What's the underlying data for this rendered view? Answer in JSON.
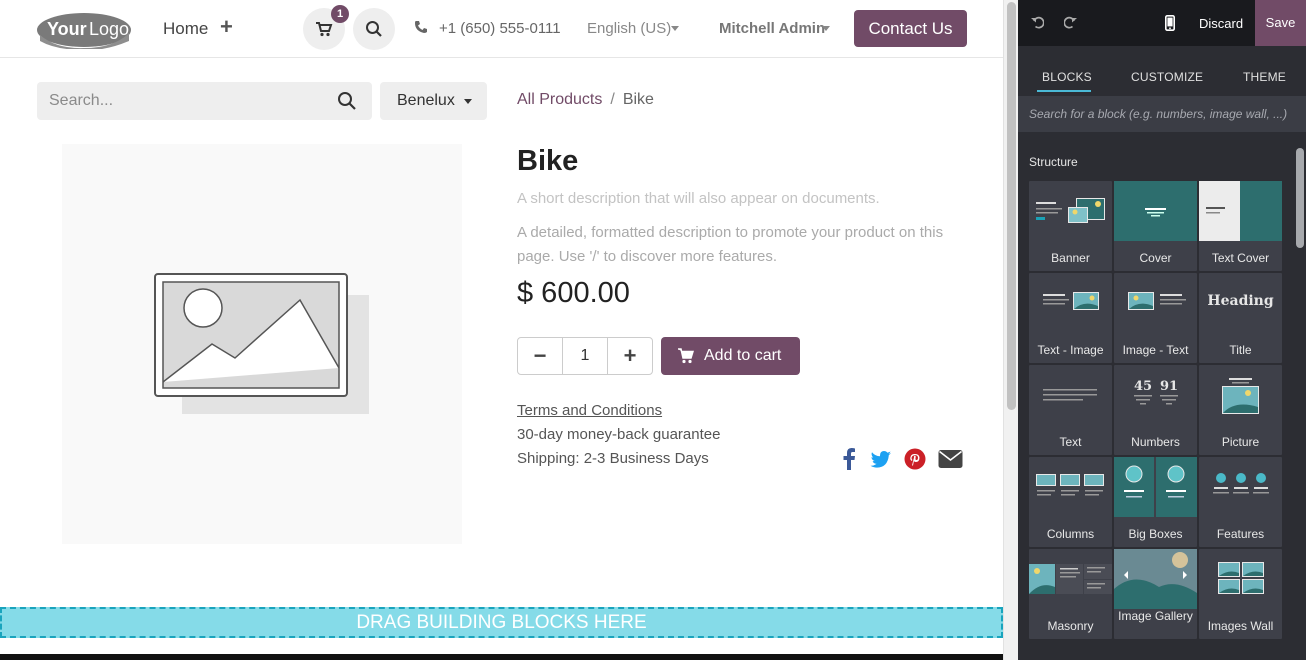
{
  "header": {
    "logo_alt": "Your Logo",
    "nav_home": "Home",
    "nav_add": "+",
    "cart_count": "1",
    "phone": "+1 (650) 555-0111",
    "language": "English (US)",
    "user": "Mitchell Admin",
    "contact_label": "Contact Us"
  },
  "toolbar": {
    "search_placeholder": "Search...",
    "pricelist": "Benelux",
    "breadcrumb": {
      "parent": "All Products",
      "sep": "/",
      "current": "Bike"
    }
  },
  "product": {
    "title": "Bike",
    "short_description": "A short description that will also appear on documents.",
    "long_description": "A detailed, formatted description to promote your product on this page. Use '/' to discover more features.",
    "price": "$ 600.00",
    "quantity": "1",
    "minus": "−",
    "plus": "+",
    "add_to_cart": "Add to cart",
    "terms": "Terms and Conditions",
    "guarantee": "30-day money-back guarantee",
    "shipping": "Shipping: 2-3 Business Days",
    "share_icons": [
      "facebook-icon",
      "twitter-icon",
      "pinterest-icon",
      "envelope-icon"
    ]
  },
  "dropzone": "DRAG BUILDING BLOCKS HERE",
  "editor": {
    "discard": "Discard",
    "save": "Save",
    "tabs": [
      "BLOCKS",
      "CUSTOMIZE",
      "THEME"
    ],
    "search_placeholder": "Search for a block (e.g. numbers, image wall, ...)",
    "section": "Structure",
    "blocks": [
      {
        "label": "Banner"
      },
      {
        "label": "Cover"
      },
      {
        "label": "Text Cover"
      },
      {
        "label": "Text - Image"
      },
      {
        "label": "Image - Text"
      },
      {
        "label": "Title",
        "thumb_text": "Heading"
      },
      {
        "label": "Text"
      },
      {
        "label": "Numbers",
        "thumb_text_a": "45",
        "thumb_text_b": "91"
      },
      {
        "label": "Picture"
      },
      {
        "label": "Columns"
      },
      {
        "label": "Big Boxes"
      },
      {
        "label": "Features"
      },
      {
        "label": "Masonry"
      },
      {
        "label": "Image Gallery"
      },
      {
        "label": "Images Wall"
      }
    ]
  },
  "colors": {
    "brand": "#714b67",
    "dropzone": "#85dbe8",
    "editor_bg": "#2c2d33",
    "teal": "#2d6e6e"
  }
}
